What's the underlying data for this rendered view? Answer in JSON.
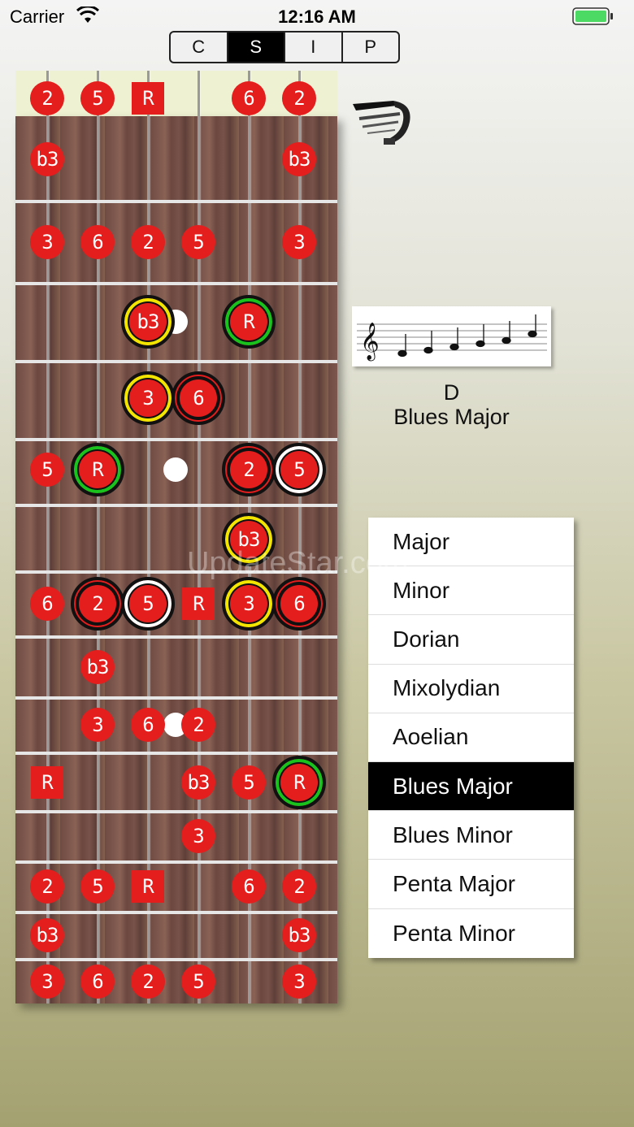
{
  "status_bar": {
    "carrier": "Carrier",
    "time": "12:16 AM"
  },
  "segments": [
    {
      "label": "C",
      "active": false
    },
    {
      "label": "S",
      "active": true
    },
    {
      "label": "I",
      "active": false
    },
    {
      "label": "P",
      "active": false
    }
  ],
  "scale": {
    "key": "D",
    "name": "Blues Major"
  },
  "scale_list": {
    "items": [
      "Major",
      "Minor",
      "Dorian",
      "Mixolydian",
      "Aoelian",
      "Blues Major",
      "Blues Minor",
      "Penta Major",
      "Penta Minor"
    ],
    "selected": "Blues Major"
  },
  "watermark": "UpdateStar.com",
  "fretboard": {
    "strings": 6,
    "notes": [
      {
        "label": "2",
        "string": 0,
        "row": 0
      },
      {
        "label": "5",
        "string": 1,
        "row": 0
      },
      {
        "label": "R",
        "string": 2,
        "row": 0,
        "shape": "square"
      },
      {
        "label": "6",
        "string": 4,
        "row": 0
      },
      {
        "label": "2",
        "string": 5,
        "row": 0
      },
      {
        "label": "b3",
        "string": 0,
        "row": 1
      },
      {
        "label": "b3",
        "string": 5,
        "row": 1
      },
      {
        "label": "3",
        "string": 0,
        "row": 2
      },
      {
        "label": "6",
        "string": 1,
        "row": 2
      },
      {
        "label": "2",
        "string": 2,
        "row": 2
      },
      {
        "label": "5",
        "string": 3,
        "row": 2
      },
      {
        "label": "3",
        "string": 5,
        "row": 2
      },
      {
        "label": "b3",
        "string": 2,
        "row": 3,
        "ring": "yellow"
      },
      {
        "label": "R",
        "string": 4,
        "row": 3,
        "ring": "green"
      },
      {
        "label": "3",
        "string": 2,
        "row": 4,
        "ring": "yellow"
      },
      {
        "label": "6",
        "string": 3,
        "row": 4,
        "ring": "red"
      },
      {
        "label": "5",
        "string": 0,
        "row": 5
      },
      {
        "label": "R",
        "string": 1,
        "row": 5,
        "ring": "green"
      },
      {
        "label": "2",
        "string": 4,
        "row": 5,
        "ring": "red"
      },
      {
        "label": "5",
        "string": 5,
        "row": 5,
        "ring": "white"
      },
      {
        "label": "b3",
        "string": 4,
        "row": 6,
        "ring": "yellow"
      },
      {
        "label": "6",
        "string": 0,
        "row": 7
      },
      {
        "label": "2",
        "string": 1,
        "row": 7,
        "ring": "red"
      },
      {
        "label": "5",
        "string": 2,
        "row": 7,
        "ring": "white"
      },
      {
        "label": "R",
        "string": 3,
        "row": 7,
        "shape": "square"
      },
      {
        "label": "3",
        "string": 4,
        "row": 7,
        "ring": "yellow"
      },
      {
        "label": "6",
        "string": 5,
        "row": 7,
        "ring": "red"
      },
      {
        "label": "b3",
        "string": 1,
        "row": 8
      },
      {
        "label": "3",
        "string": 1,
        "row": 9
      },
      {
        "label": "6",
        "string": 2,
        "row": 9
      },
      {
        "label": "2",
        "string": 3,
        "row": 9
      },
      {
        "label": "R",
        "string": 0,
        "row": 10,
        "shape": "square"
      },
      {
        "label": "b3",
        "string": 3,
        "row": 10
      },
      {
        "label": "5",
        "string": 4,
        "row": 10
      },
      {
        "label": "R",
        "string": 5,
        "row": 10,
        "ring": "green"
      },
      {
        "label": "3",
        "string": 3,
        "row": 11
      },
      {
        "label": "2",
        "string": 0,
        "row": 12
      },
      {
        "label": "5",
        "string": 1,
        "row": 12
      },
      {
        "label": "R",
        "string": 2,
        "row": 12,
        "shape": "square"
      },
      {
        "label": "6",
        "string": 4,
        "row": 12
      },
      {
        "label": "2",
        "string": 5,
        "row": 12
      },
      {
        "label": "b3",
        "string": 0,
        "row": 13
      },
      {
        "label": "b3",
        "string": 5,
        "row": 13
      },
      {
        "label": "3",
        "string": 0,
        "row": 14
      },
      {
        "label": "6",
        "string": 1,
        "row": 14
      },
      {
        "label": "2",
        "string": 2,
        "row": 14
      },
      {
        "label": "5",
        "string": 3,
        "row": 14
      },
      {
        "label": "3",
        "string": 5,
        "row": 14
      }
    ]
  }
}
